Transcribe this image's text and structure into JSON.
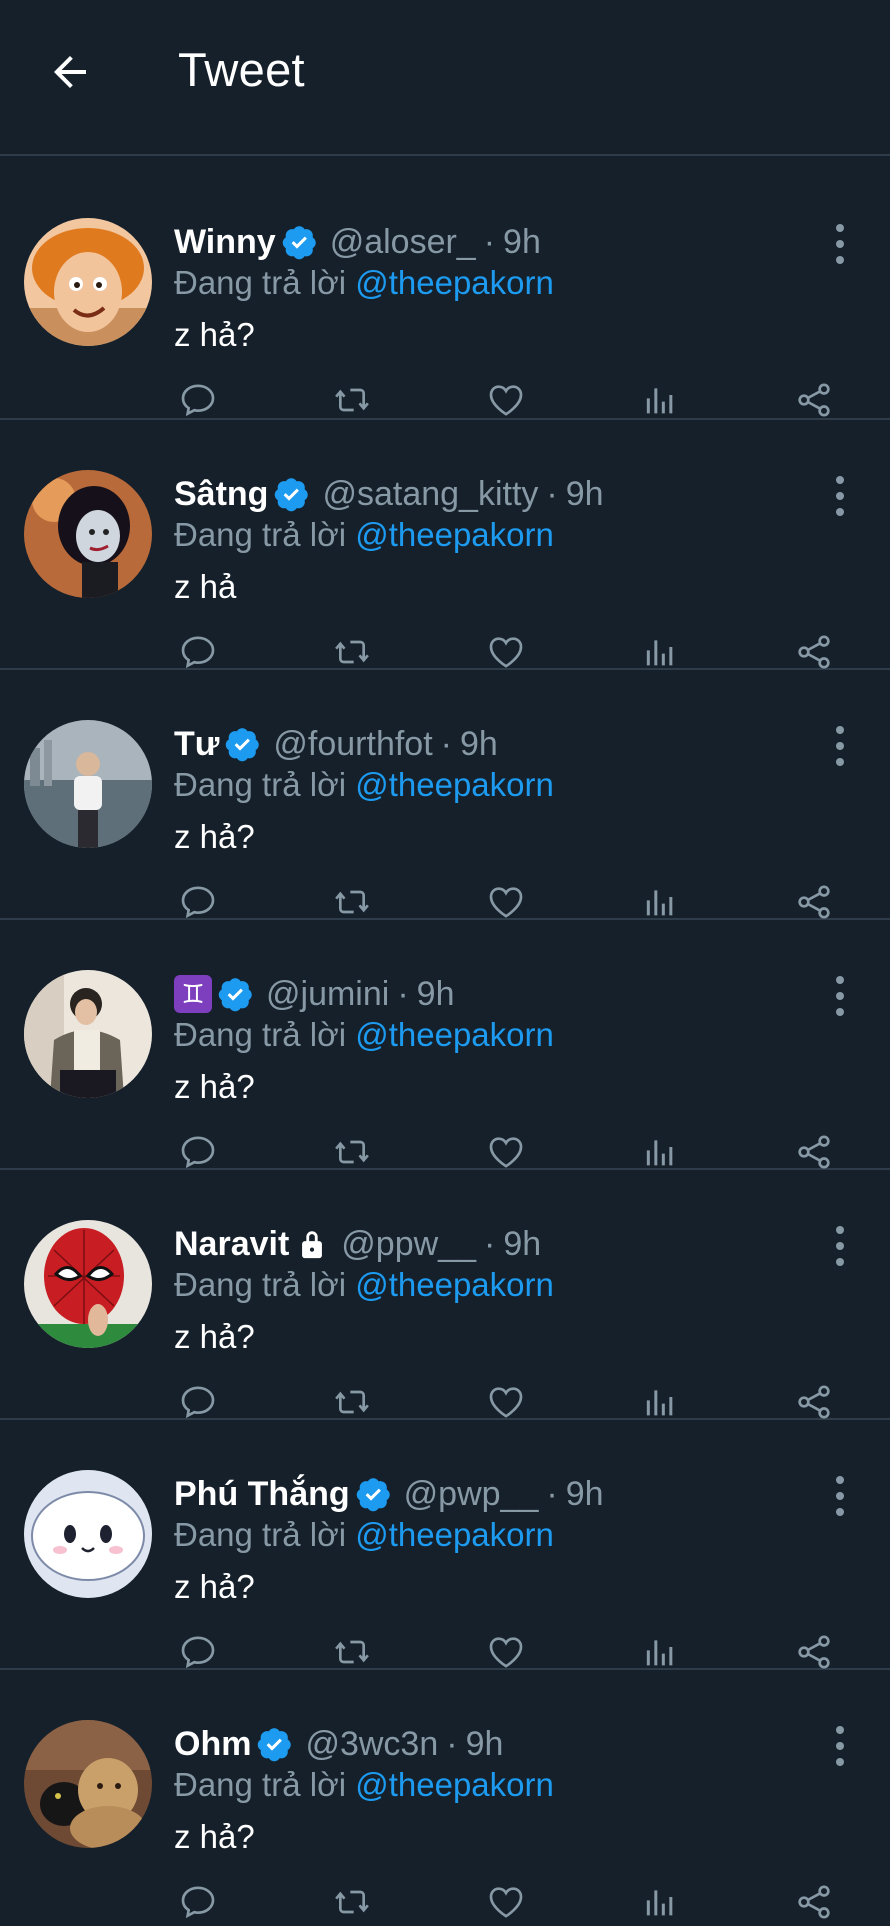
{
  "header": {
    "title": "Tweet",
    "back_icon": "arrow-left-icon"
  },
  "reply_prefix": "Đang trả lời",
  "tweets": [
    {
      "name": "Winny",
      "verified": true,
      "handle": "@aloser_",
      "time": "9h",
      "replying_to": "@theepakorn",
      "text": "z hả?"
    },
    {
      "name": "Sâtng",
      "verified": true,
      "handle": "@satang_kitty",
      "time": "9h",
      "replying_to": "@theepakorn",
      "text": "z hả"
    },
    {
      "name": "Tư",
      "verified": true,
      "handle": "@fourthfot",
      "time": "9h",
      "replying_to": "@theepakorn",
      "text": "z hả?"
    },
    {
      "name": "♊",
      "verified": true,
      "handle": "@jumini",
      "time": "9h",
      "replying_to": "@theepakorn",
      "text": "z hả?"
    },
    {
      "name": "Naravit",
      "verified": false,
      "locked": true,
      "handle": "@ppw__",
      "time": "9h",
      "replying_to": "@theepakorn",
      "text": "z hả?"
    },
    {
      "name": "Phú Thắng",
      "verified": true,
      "handle": "@pwp__",
      "time": "9h",
      "replying_to": "@theepakorn",
      "text": "z hả?"
    },
    {
      "name": "Ohm",
      "verified": true,
      "handle": "@3wc3n",
      "time": "9h",
      "replying_to": "@theepakorn",
      "text": "z hả?"
    }
  ],
  "colors": {
    "background": "#15202b",
    "divider": "#2f3d4b",
    "muted": "#8899a6",
    "accent": "#1d9bf0"
  },
  "action_icons": [
    "reply-icon",
    "retweet-icon",
    "like-icon",
    "analytics-icon",
    "share-icon"
  ]
}
